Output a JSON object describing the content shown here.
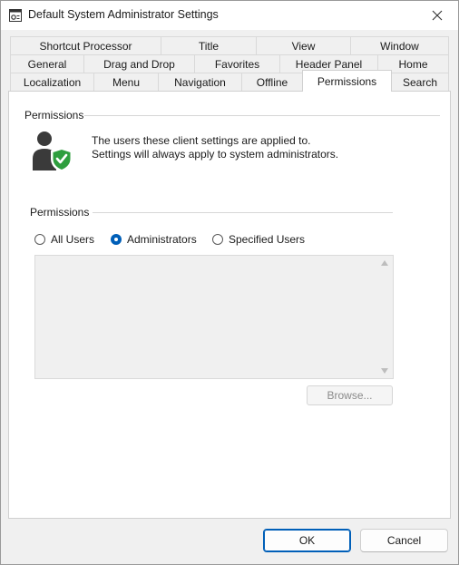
{
  "window": {
    "title": "Default System Administrator Settings"
  },
  "tabs": {
    "row1": [
      "Shortcut Processor",
      "Title",
      "View",
      "Window"
    ],
    "row2": [
      "General",
      "Drag and Drop",
      "Favorites",
      "Header Panel",
      "Home"
    ],
    "row3": [
      "Localization",
      "Menu",
      "Navigation",
      "Offline",
      "Permissions",
      "Search"
    ],
    "selected": "Permissions"
  },
  "permissions_group": {
    "label": "Permissions",
    "info_line1": "The users these client settings are applied to.",
    "info_line2": "Settings will always apply to system administrators.",
    "icon": "user-shield-check-icon"
  },
  "inner_group": {
    "label": "Permissions",
    "options": [
      "All Users",
      "Administrators",
      "Specified Users"
    ],
    "selected_option": "Administrators",
    "users_list": [],
    "browse_label": "Browse..."
  },
  "footer": {
    "ok_label": "OK",
    "cancel_label": "Cancel"
  },
  "colors": {
    "accent": "#005fb8",
    "shield": "#2e9e3e",
    "user": "#3a3a3a"
  }
}
